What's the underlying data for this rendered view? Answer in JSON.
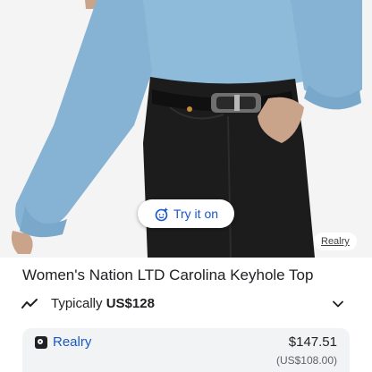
{
  "product": {
    "title": "Women's Nation LTD Carolina Keyhole Top",
    "image_source": "Realry"
  },
  "try_on": {
    "label": "Try it on"
  },
  "price_insight": {
    "prefix": "Typically",
    "amount": "US$128"
  },
  "offer": {
    "store": "Realry",
    "price": "$147.51",
    "converted_price": "(US$108.00)"
  },
  "colors": {
    "accent": "#1a57c9",
    "top_blue": "#8ab6d6",
    "jeans_black": "#1c1c1c"
  },
  "icons": {
    "try_on": "sparkle-face-icon",
    "trend": "trending-line-icon",
    "expand": "chevron-down-icon",
    "store": "store-logo-icon"
  }
}
